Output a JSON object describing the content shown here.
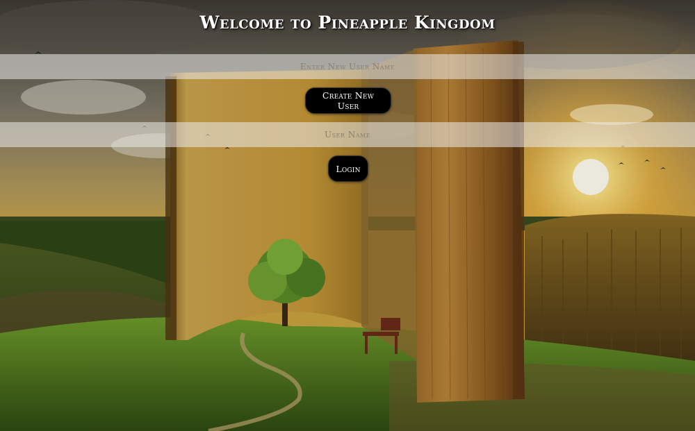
{
  "header": {
    "title": "Welcome to Pineapple Kingdom"
  },
  "create_form": {
    "new_user_placeholder": "Enter New User Name",
    "new_user_value": "",
    "create_button_label": "Create New User"
  },
  "login_form": {
    "user_placeholder": "User Name",
    "user_value": "",
    "login_button_label": "Login"
  },
  "background": {
    "description_icon": "open-book-landscape-image",
    "colors": {
      "sky_top": "#4b4539",
      "sun": "#fff6c8",
      "grass": "#4f7a1e",
      "book_page": "#b8892f",
      "book_spine": "#7a4a18",
      "button_bg": "#000000",
      "field_bg": "#ebebeb"
    }
  }
}
